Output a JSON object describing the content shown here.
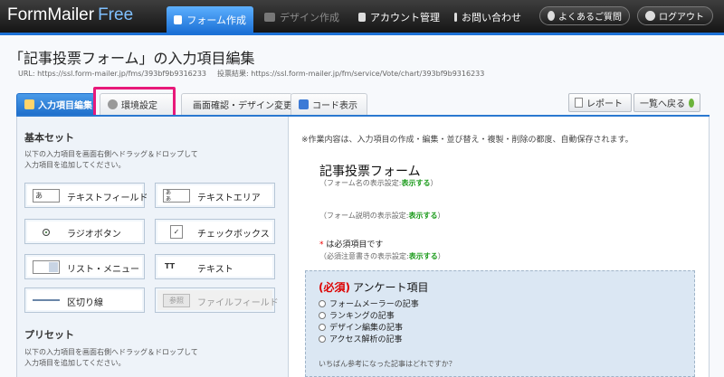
{
  "app": {
    "logo_main": "FormMailer",
    "logo_free": "Free"
  },
  "nav": {
    "form": "フォーム作成",
    "design": "デザイン作成",
    "account": "アカウント管理",
    "contact": "お問い合わせ",
    "faq": "よくあるご質問",
    "logout": "ログアウト"
  },
  "header": {
    "title": "「記事投票フォーム」の入力項目編集",
    "url_label": "URL: https://ssl.form-mailer.jp/fms/393bf9b9316233",
    "result_label": "投票結果: https://ssl.form-mailer.jp/fm/service/Vote/chart/393bf9b9316233"
  },
  "tabs": [
    {
      "label": "入力項目編集"
    },
    {
      "label": "環境設定"
    },
    {
      "label": "画面確認・デザイン変更"
    },
    {
      "label": "コード表示"
    }
  ],
  "actions": {
    "report": "レポート",
    "back": "一覧へ戻る"
  },
  "left": {
    "basic_title": "基本セット",
    "basic_desc_1": "以下の入力項目を画面右側へドラッグ＆ドロップして",
    "basic_desc_2": "入力項目を追加してください。",
    "fields": [
      {
        "icon_text": "あ",
        "label": "テキストフィールド"
      },
      {
        "icon_text": "あ\nあ",
        "label": "テキストエリア"
      },
      {
        "icon_text": "",
        "label": "ラジオボタン"
      },
      {
        "icon_text": "✓",
        "label": "チェックボックス"
      },
      {
        "icon_text": "",
        "label": "リスト・メニュー"
      },
      {
        "icon_text": "TT",
        "label": "テキスト"
      },
      {
        "icon_text": "",
        "label": "区切り線"
      },
      {
        "icon_text": "参照",
        "label": "ファイルフィールド"
      }
    ],
    "preset_title": "プリセット",
    "preset_desc_1": "以下の入力項目を画面右側へドラッグ＆ドロップして",
    "preset_desc_2": "入力項目を追加してください。"
  },
  "right": {
    "autosave": "※作業内容は、入力項目の作成・編集・並び替え・複製・削除の都度、自動保存されます。",
    "form_title": "記事投票フォーム",
    "name_setting_prefix": "（フォーム名の表示設定:",
    "name_setting_link": "表示する",
    "name_setting_suffix": "）",
    "desc_setting_prefix": "（フォーム説明の表示設定:",
    "desc_setting_link": "表示する",
    "desc_setting_suffix": "）",
    "req_mark": "*",
    "req_text": " は必須項目です",
    "req_setting_prefix": "（必須注意書きの表示設定:",
    "req_setting_link": "表示する",
    "req_setting_suffix": "）",
    "question": {
      "required": "(必須)",
      "title": "アンケート項目",
      "options": [
        "フォームメーラーの記事",
        "ランキングの記事",
        "デザイン編集の記事",
        "アクセス解析の記事"
      ],
      "help": "いちばん参考になった記事はどれですか？"
    }
  }
}
